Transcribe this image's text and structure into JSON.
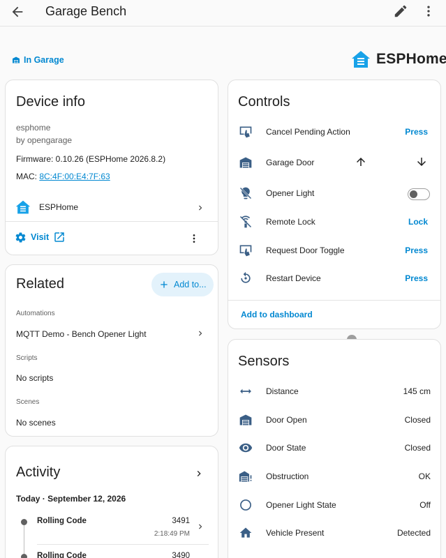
{
  "header": {
    "title": "Garage Bench"
  },
  "area": {
    "label": "In Garage"
  },
  "brand": {
    "name": "ESPHome"
  },
  "device_info": {
    "title": "Device info",
    "model": "esphome",
    "manufacturer": "by opengarage",
    "firmware": "Firmware: 0.10.26 (ESPHome 2026.8.2)",
    "mac_label": "MAC: ",
    "mac_value": "8C:4F:00:E4:7F:63",
    "integration": "ESPHome",
    "visit": "Visit"
  },
  "related": {
    "title": "Related",
    "add_label": "Add to...",
    "sections": [
      {
        "heading": "Automations",
        "item": "MQTT Demo - Bench Opener Light"
      },
      {
        "heading": "Scripts",
        "item": "No scripts"
      },
      {
        "heading": "Scenes",
        "item": "No scenes"
      }
    ]
  },
  "activity": {
    "title": "Activity",
    "date": "Today · September 12, 2026",
    "entries": [
      {
        "name": "Rolling Code",
        "value": "3491",
        "time": "2:18:49 PM"
      },
      {
        "name": "Rolling Code",
        "value": "3490"
      }
    ]
  },
  "controls": {
    "title": "Controls",
    "rows": [
      {
        "label": "Cancel Pending Action",
        "action": "Press",
        "icon": "touch-press-icon"
      },
      {
        "label": "Garage Door",
        "icon": "garage-icon"
      },
      {
        "label": "Opener Light",
        "icon": "lightbulb-off-icon",
        "state": "off"
      },
      {
        "label": "Remote Lock",
        "action": "Lock",
        "icon": "remote-off-icon"
      },
      {
        "label": "Request Door Toggle",
        "action": "Press",
        "icon": "touch-press-icon"
      },
      {
        "label": "Restart Device",
        "action": "Press",
        "icon": "restart-icon"
      }
    ],
    "add_to_dashboard": "Add to dashboard"
  },
  "sensors": {
    "title": "Sensors",
    "rows": [
      {
        "label": "Distance",
        "value": "145 cm",
        "icon": "arrow-left-right-icon"
      },
      {
        "label": "Door Open",
        "value": "Closed",
        "icon": "garage-icon"
      },
      {
        "label": "Door State",
        "value": "Closed",
        "icon": "eye-icon"
      },
      {
        "label": "Obstruction",
        "value": "OK",
        "icon": "garage-alert-icon"
      },
      {
        "label": "Opener Light State",
        "value": "Off",
        "icon": "circle-outline-icon"
      },
      {
        "label": "Vehicle Present",
        "value": "Detected",
        "icon": "home-icon"
      }
    ]
  },
  "colors": {
    "accent": "#0288d1",
    "icon": "#3b5f86",
    "brand": "#18a2e8"
  }
}
